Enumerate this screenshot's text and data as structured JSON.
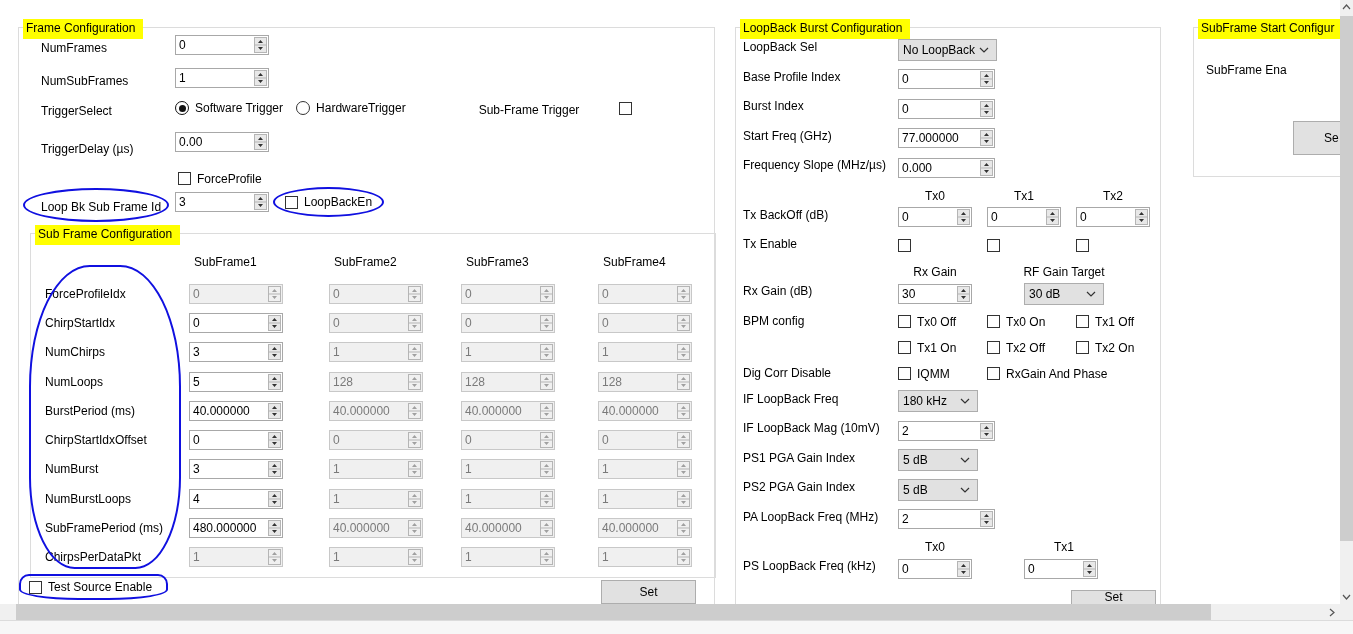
{
  "frame": {
    "title": "Frame Configuration",
    "highlighted": true,
    "rows": [
      {
        "kind": "spin",
        "label": "NumFrames",
        "value": "0"
      },
      {
        "kind": "spin",
        "label": "NumSubFrames",
        "value": "1"
      },
      {
        "kind": "trigger",
        "label": "TriggerSelect",
        "options": [
          {
            "label": "Software Trigger",
            "selected": true
          },
          {
            "label": "HardwareTrigger",
            "selected": false
          }
        ],
        "extra": {
          "label": "Sub-Frame Trigger",
          "checked": false
        }
      },
      {
        "kind": "spin",
        "label": "TriggerDelay (µs)",
        "value": "0.00"
      },
      {
        "kind": "check",
        "checkbox": {
          "label": "ForceProfile",
          "checked": false
        }
      },
      {
        "kind": "spin_check",
        "label": "Loop Bk Sub Frame Id",
        "circled": true,
        "value": "3",
        "checkbox": {
          "label": "LoopBackEn",
          "checked": false,
          "circled": true
        }
      }
    ]
  },
  "subframe": {
    "title": "Sub Frame Configuration",
    "highlighted": true,
    "labels_circled": true,
    "columns": [
      "SubFrame1",
      "SubFrame2",
      "SubFrame3",
      "SubFrame4"
    ],
    "rows": [
      {
        "label": "ForceProfileIdx",
        "cells": [
          {
            "value": "0",
            "disabled": true
          },
          {
            "value": "0",
            "disabled": true
          },
          {
            "value": "0",
            "disabled": true
          },
          {
            "value": "0",
            "disabled": true
          }
        ]
      },
      {
        "label": "ChirpStartIdx",
        "cells": [
          {
            "value": "0",
            "disabled": false
          },
          {
            "value": "0",
            "disabled": true
          },
          {
            "value": "0",
            "disabled": true
          },
          {
            "value": "0",
            "disabled": true
          }
        ]
      },
      {
        "label": "NumChirps",
        "cells": [
          {
            "value": "3",
            "disabled": false
          },
          {
            "value": "1",
            "disabled": true
          },
          {
            "value": "1",
            "disabled": true
          },
          {
            "value": "1",
            "disabled": true
          }
        ]
      },
      {
        "label": "NumLoops",
        "cells": [
          {
            "value": "5",
            "disabled": false
          },
          {
            "value": "128",
            "disabled": true
          },
          {
            "value": "128",
            "disabled": true
          },
          {
            "value": "128",
            "disabled": true
          }
        ]
      },
      {
        "label": "BurstPeriod (ms)",
        "cells": [
          {
            "value": "40.000000",
            "disabled": false
          },
          {
            "value": "40.000000",
            "disabled": true
          },
          {
            "value": "40.000000",
            "disabled": true
          },
          {
            "value": "40.000000",
            "disabled": true
          }
        ]
      },
      {
        "label": "ChirpStartIdxOffset",
        "cells": [
          {
            "value": "0",
            "disabled": false
          },
          {
            "value": "0",
            "disabled": true
          },
          {
            "value": "0",
            "disabled": true
          },
          {
            "value": "0",
            "disabled": true
          }
        ]
      },
      {
        "label": "NumBurst",
        "cells": [
          {
            "value": "3",
            "disabled": false
          },
          {
            "value": "1",
            "disabled": true
          },
          {
            "value": "1",
            "disabled": true
          },
          {
            "value": "1",
            "disabled": true
          }
        ]
      },
      {
        "label": "NumBurstLoops",
        "cells": [
          {
            "value": "4",
            "disabled": false
          },
          {
            "value": "1",
            "disabled": true
          },
          {
            "value": "1",
            "disabled": true
          },
          {
            "value": "1",
            "disabled": true
          }
        ]
      },
      {
        "label": "SubFramePeriod (ms)",
        "cells": [
          {
            "value": "480.000000",
            "disabled": false
          },
          {
            "value": "40.000000",
            "disabled": true
          },
          {
            "value": "40.000000",
            "disabled": true
          },
          {
            "value": "40.000000",
            "disabled": true
          }
        ]
      },
      {
        "label": "ChirpsPerDataPkt",
        "cells": [
          {
            "value": "1",
            "disabled": true
          },
          {
            "value": "1",
            "disabled": true
          },
          {
            "value": "1",
            "disabled": true
          },
          {
            "value": "1",
            "disabled": true
          }
        ]
      }
    ]
  },
  "test_source": {
    "label": "Test Source Enable",
    "checked": false,
    "circled": true
  },
  "frame_set_button": "Set",
  "loopback": {
    "title": "LoopBack Burst Configuration",
    "highlighted": true,
    "rows": [
      {
        "kind": "field",
        "label": "LoopBack Sel",
        "items": [
          {
            "kind": "select",
            "value": "No LoopBack"
          }
        ]
      },
      {
        "kind": "field",
        "label": "Base Profile Index",
        "items": [
          {
            "kind": "spin",
            "value": "0"
          }
        ]
      },
      {
        "kind": "field",
        "label": "Burst Index",
        "items": [
          {
            "kind": "spin",
            "value": "0"
          }
        ]
      },
      {
        "kind": "field",
        "label": "Start Freq (GHz)",
        "items": [
          {
            "kind": "spin",
            "value": "77.000000"
          }
        ]
      },
      {
        "kind": "field",
        "label": "Frequency Slope (MHz/µs)",
        "items": [
          {
            "kind": "spin",
            "value": "0.000"
          }
        ]
      },
      {
        "kind": "header",
        "items": [
          "Tx0",
          "Tx1",
          "Tx2"
        ]
      },
      {
        "kind": "grid",
        "label": "Tx BackOff (dB)",
        "items": [
          {
            "kind": "spin",
            "value": "0"
          },
          {
            "kind": "spin",
            "value": "0"
          },
          {
            "kind": "spin",
            "value": "0"
          }
        ]
      },
      {
        "kind": "grid",
        "label": "Tx Enable",
        "items": [
          {
            "kind": "check",
            "checked": false
          },
          {
            "kind": "check",
            "checked": false
          },
          {
            "kind": "check",
            "checked": false
          }
        ]
      },
      {
        "kind": "header_wide",
        "items": [
          "Rx Gain",
          "RF Gain Target"
        ]
      },
      {
        "kind": "grid_wide",
        "label": "Rx Gain (dB)",
        "items": [
          {
            "kind": "spin",
            "value": "30"
          },
          {
            "kind": "select",
            "value": "30 dB"
          }
        ]
      },
      {
        "kind": "grid",
        "label": "BPM config",
        "items": [
          {
            "kind": "check",
            "label": "Tx0 Off",
            "checked": false
          },
          {
            "kind": "check",
            "label": "Tx0 On",
            "checked": false
          },
          {
            "kind": "check",
            "label": "Tx1 Off",
            "checked": false
          }
        ]
      },
      {
        "kind": "grid",
        "items": [
          {
            "kind": "check",
            "label": "Tx1 On",
            "checked": false
          },
          {
            "kind": "check",
            "label": "Tx2 Off",
            "checked": false
          },
          {
            "kind": "check",
            "label": "Tx2 On",
            "checked": false
          }
        ]
      },
      {
        "kind": "grid",
        "label": "Dig Corr Disable",
        "items": [
          {
            "kind": "check",
            "label": "IQMM",
            "checked": false
          },
          {
            "kind": "check",
            "label": "RxGain And Phase",
            "checked": false
          }
        ]
      },
      {
        "kind": "field",
        "label": "IF LoopBack Freq",
        "items": [
          {
            "kind": "select",
            "value": "180 kHz"
          }
        ]
      },
      {
        "kind": "field",
        "label": "IF LoopBack Mag (10mV)",
        "items": [
          {
            "kind": "spin",
            "value": "2"
          }
        ]
      },
      {
        "kind": "field",
        "label": "PS1 PGA Gain Index",
        "items": [
          {
            "kind": "select",
            "value": "5 dB"
          }
        ]
      },
      {
        "kind": "field",
        "label": "PS2 PGA Gain Index",
        "items": [
          {
            "kind": "select",
            "value": "5 dB"
          }
        ]
      },
      {
        "kind": "field",
        "label": "PA LoopBack Freq (MHz)",
        "items": [
          {
            "kind": "spin",
            "value": "2"
          }
        ]
      },
      {
        "kind": "header_wide",
        "items": [
          "Tx0",
          "Tx1"
        ]
      },
      {
        "kind": "grid_wide",
        "label": "PS LoopBack Freq (kHz)",
        "items": [
          {
            "kind": "spin",
            "value": "0"
          },
          {
            "kind": "spin",
            "value": "0"
          }
        ]
      }
    ],
    "set_button": "Set"
  },
  "subframe_start": {
    "title": "SubFrame Start Configur",
    "highlighted": true,
    "label": "SubFrame Ena",
    "set_button": "Se"
  }
}
